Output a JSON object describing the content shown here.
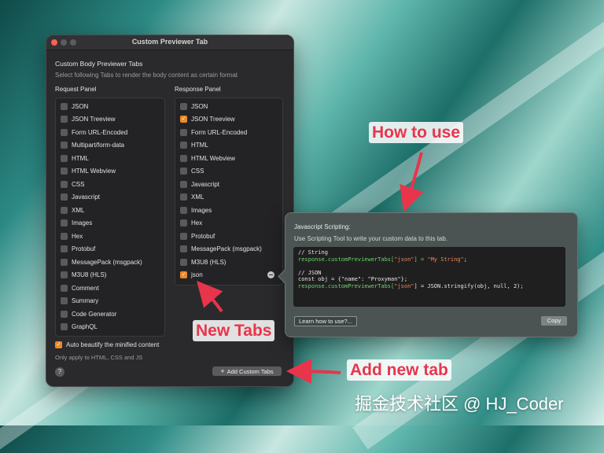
{
  "window": {
    "title": "Custom Previewer Tab",
    "heading": "Custom Body Previewer Tabs",
    "subheading": "Select following Tabs to render the body content as certain format"
  },
  "request_panel": {
    "label": "Request Panel",
    "items": [
      {
        "label": "JSON",
        "checked": false
      },
      {
        "label": "JSON Treeview",
        "checked": false
      },
      {
        "label": "Form URL-Encoded",
        "checked": false
      },
      {
        "label": "Multipart/form-data",
        "checked": false
      },
      {
        "label": "HTML",
        "checked": false
      },
      {
        "label": "HTML Webview",
        "checked": false
      },
      {
        "label": "CSS",
        "checked": false
      },
      {
        "label": "Javascript",
        "checked": false
      },
      {
        "label": "XML",
        "checked": false
      },
      {
        "label": "Images",
        "checked": false
      },
      {
        "label": "Hex",
        "checked": false
      },
      {
        "label": "Protobuf",
        "checked": false
      },
      {
        "label": "MessagePack (msgpack)",
        "checked": false
      },
      {
        "label": "M3U8 (HLS)",
        "checked": false
      },
      {
        "label": "Comment",
        "checked": false
      },
      {
        "label": "Summary",
        "checked": false
      },
      {
        "label": "Code Generator",
        "checked": false
      },
      {
        "label": "GraphQL",
        "checked": false
      }
    ]
  },
  "response_panel": {
    "label": "Response Panel",
    "items": [
      {
        "label": "JSON",
        "checked": false
      },
      {
        "label": "JSON Treeview",
        "checked": true
      },
      {
        "label": "Form URL-Encoded",
        "checked": false
      },
      {
        "label": "HTML",
        "checked": false
      },
      {
        "label": "HTML Webview",
        "checked": false
      },
      {
        "label": "CSS",
        "checked": false
      },
      {
        "label": "Javascript",
        "checked": false
      },
      {
        "label": "XML",
        "checked": false
      },
      {
        "label": "Images",
        "checked": false
      },
      {
        "label": "Hex",
        "checked": false
      },
      {
        "label": "Protobuf",
        "checked": false
      },
      {
        "label": "MessagePack (msgpack)",
        "checked": false
      },
      {
        "label": "M3U8 (HLS)",
        "checked": false
      },
      {
        "label": "json",
        "checked": true
      }
    ]
  },
  "options": {
    "beautify_label": "Auto beautify the minified content",
    "beautify_checked": true,
    "note": "Only apply to HTML, CSS and JS",
    "help_label": "?",
    "add_button_label": "Add Custom Tabs",
    "add_button_icon": "+"
  },
  "popover": {
    "title": "Javascript Scripting:",
    "subtitle": "Use Scripting Tool to write your custom data to this tab.",
    "code": {
      "comment1": "// String",
      "line1_obj": "response.customPreviewerTabs[",
      "line1_key": "\"json\"",
      "line1_mid": "] = ",
      "line1_val": "\"My String\"",
      "line1_end": ";",
      "comment2": "// JSON",
      "line2": "const obj = {\"name\": \"Proxyman\"};",
      "line3_obj": "response.customPreviewerTabs[",
      "line3_key": "\"json\"",
      "line3_rest": "] = JSON.stringify(obj, null, 2);"
    },
    "learn_label": "Learn how to use?...",
    "copy_label": "Copy"
  },
  "annotations": {
    "how_to_use": "How to use",
    "new_tabs": "New Tabs",
    "add_new_tab": "Add new tab",
    "color": "#e8354c"
  },
  "watermark": "掘金技术社区 @ HJ_Coder"
}
